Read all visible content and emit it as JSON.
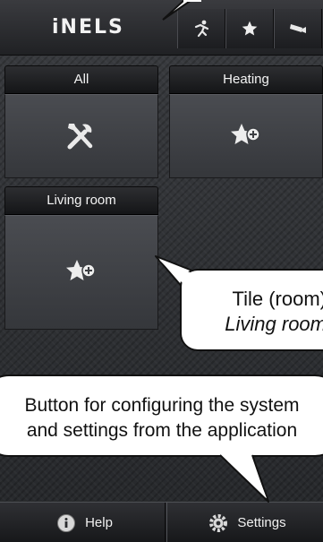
{
  "header": {
    "logo_text": "iNELS",
    "buttons": [
      {
        "name": "scenes",
        "icon": "running-person-icon"
      },
      {
        "name": "favorites",
        "icon": "star-icon"
      },
      {
        "name": "camera",
        "icon": "camera-icon"
      }
    ]
  },
  "tiles": [
    {
      "label": "All",
      "icon": "tools-icon"
    },
    {
      "label": "Heating",
      "icon": "star-add-icon"
    },
    {
      "label": "Living room",
      "icon": "star-add-icon"
    }
  ],
  "footer": {
    "help_label": "Help",
    "settings_label": "Settings"
  },
  "callouts": {
    "tile_line1": "Tile (room)",
    "tile_line2": "Living room",
    "settings_line1": "Button for configuring the system",
    "settings_line2": "and settings from the application"
  },
  "colors": {
    "background": "#2e3034",
    "bar": "#1c1d20",
    "text": "#f2f2f2",
    "callout": "#ffffff"
  }
}
